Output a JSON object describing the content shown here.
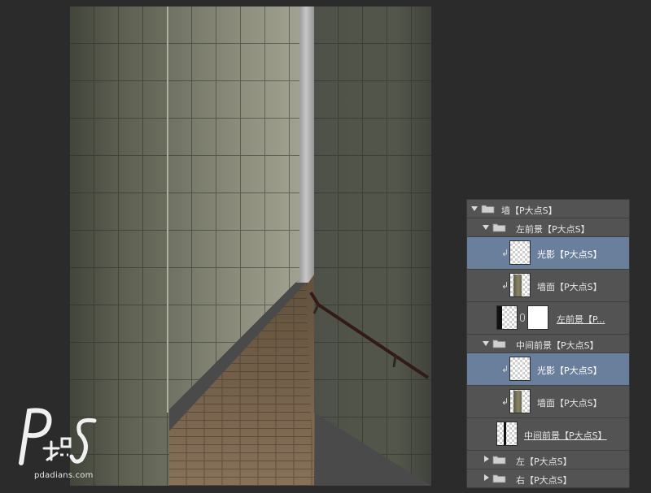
{
  "watermark": {
    "logo_text": "P大点S",
    "site": "pdadians.com"
  },
  "colors": {
    "panel_bg": "#535353",
    "selected_row": "#6a7f9c",
    "app_bg": "#2b2b2b"
  },
  "layers_panel": {
    "rows": [
      {
        "label": "墙【P大点S】",
        "kind": "group",
        "expanded": true,
        "icon": "folder-icon"
      },
      {
        "label": "左前景【P大点S】",
        "kind": "group",
        "expanded": true,
        "icon": "folder-icon"
      },
      {
        "label": "光影【P大点S】",
        "kind": "layer",
        "clipped": true,
        "selected": true,
        "icon": "transparent-thumbnail"
      },
      {
        "label": "墙面【P大点S】",
        "kind": "layer",
        "clipped": true,
        "selected": false,
        "icon": "wall-thumbnail"
      },
      {
        "label": "左前景【P...",
        "kind": "layer",
        "has_mask": true,
        "selected": false,
        "icon": "layer-thumbnail"
      },
      {
        "label": "中间前景【P大点S】",
        "kind": "group",
        "expanded": true,
        "icon": "folder-icon"
      },
      {
        "label": "光影【P大点S】",
        "kind": "layer",
        "clipped": true,
        "selected": true,
        "icon": "transparent-thumbnail"
      },
      {
        "label": "墙面【P大点S】",
        "kind": "layer",
        "clipped": true,
        "selected": false,
        "icon": "wall-thumbnail"
      },
      {
        "label": "中间前景【P大点S】",
        "kind": "layer",
        "selected": false,
        "icon": "layer-thumbnail"
      },
      {
        "label": "左【P大点S】",
        "kind": "group",
        "expanded": false,
        "icon": "folder-icon"
      },
      {
        "label": "右【P大点S】",
        "kind": "group",
        "expanded": false,
        "icon": "folder-icon"
      }
    ]
  }
}
